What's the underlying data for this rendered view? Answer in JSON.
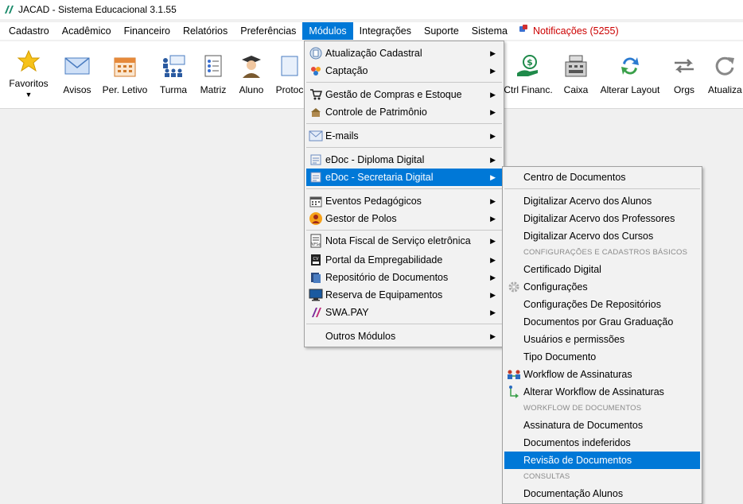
{
  "window": {
    "title": "JACAD - Sistema Educacional 3.1.55"
  },
  "menubar": {
    "items": [
      "Cadastro",
      "Acadêmico",
      "Financeiro",
      "Relatórios",
      "Preferências",
      "Módulos",
      "Integrações",
      "Suporte",
      "Sistema"
    ],
    "notifications": "Notificações (5255)"
  },
  "toolbar": {
    "favoritos": "Favoritos",
    "avisos": "Avisos",
    "per_letivo": "Per. Letivo",
    "turma": "Turma",
    "matriz": "Matriz",
    "aluno": "Aluno",
    "protocolo": "Protoc",
    "ctrl_financ": "Ctrl Financ.",
    "caixa": "Caixa",
    "alterar_layout": "Alterar Layout",
    "orgs": "Orgs",
    "atualizar": "Atualiza"
  },
  "modulos_menu": {
    "items": [
      "Atualização Cadastral",
      "Captação",
      "Gestão de Compras e Estoque",
      "Controle de Patrimônio",
      "E-mails",
      "eDoc - Diploma Digital",
      "eDoc - Secretaria Digital",
      "Eventos Pedagógicos",
      "Gestor de Polos",
      "Nota Fiscal de Serviço eletrônica",
      "Portal da Empregabilidade",
      "Repositório de Documentos",
      "Reserva de Equipamentos",
      "SWA.PAY",
      "Outros Módulos"
    ]
  },
  "secretaria_submenu": {
    "items": [
      "Centro de Documentos",
      "Digitalizar Acervo dos Alunos",
      "Digitalizar Acervo dos Professores",
      "Digitalizar Acervo dos Cursos",
      "Certificado Digital",
      "Configurações",
      "Configurações De Repositórios",
      "Documentos por Grau Graduação",
      "Usuários e permissões",
      "Tipo Documento",
      "Workflow de Assinaturas",
      "Alterar Workflow de Assinaturas",
      "Assinatura de Documentos",
      "Documentos indeferidos",
      "Revisão de Documentos",
      "Documentação Alunos"
    ],
    "headers": [
      "CONFIGURAÇÕES E CADASTROS BÁSICOS",
      "WORKFLOW DE DOCUMENTOS",
      "CONSULTAS"
    ]
  },
  "colors": {
    "highlight": "#0078d7",
    "notification": "#cc0000"
  }
}
